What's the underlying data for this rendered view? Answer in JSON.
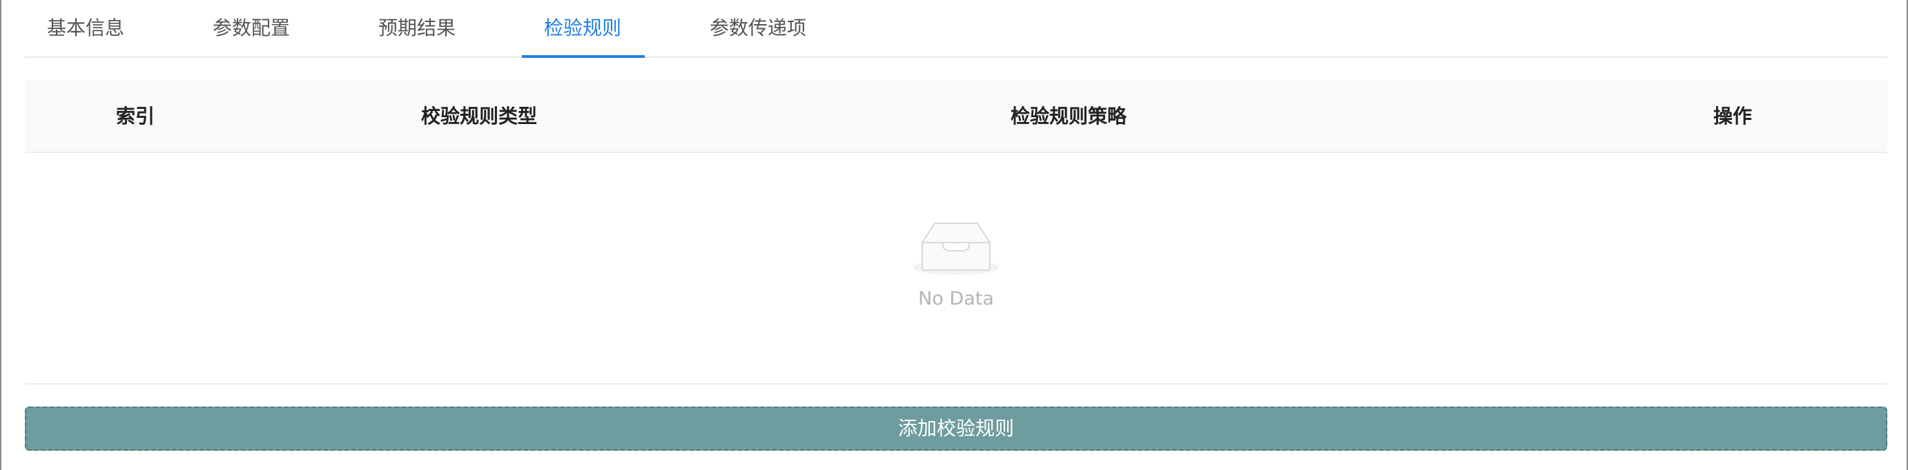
{
  "tabs": [
    {
      "label": "基本信息",
      "active": false
    },
    {
      "label": "参数配置",
      "active": false
    },
    {
      "label": "预期结果",
      "active": false
    },
    {
      "label": "检验规则",
      "active": true
    },
    {
      "label": "参数传递项",
      "active": false
    }
  ],
  "table": {
    "columns": [
      "索引",
      "校验规则类型",
      "检验规则策略",
      "操作"
    ],
    "rows": [],
    "empty_text": "No Data"
  },
  "add_button": {
    "label": "添加校验规则"
  },
  "colors": {
    "accent": "#1f7fe0",
    "button_bg": "#6f9c9e"
  },
  "icons": {
    "empty": "empty-inbox-icon"
  }
}
